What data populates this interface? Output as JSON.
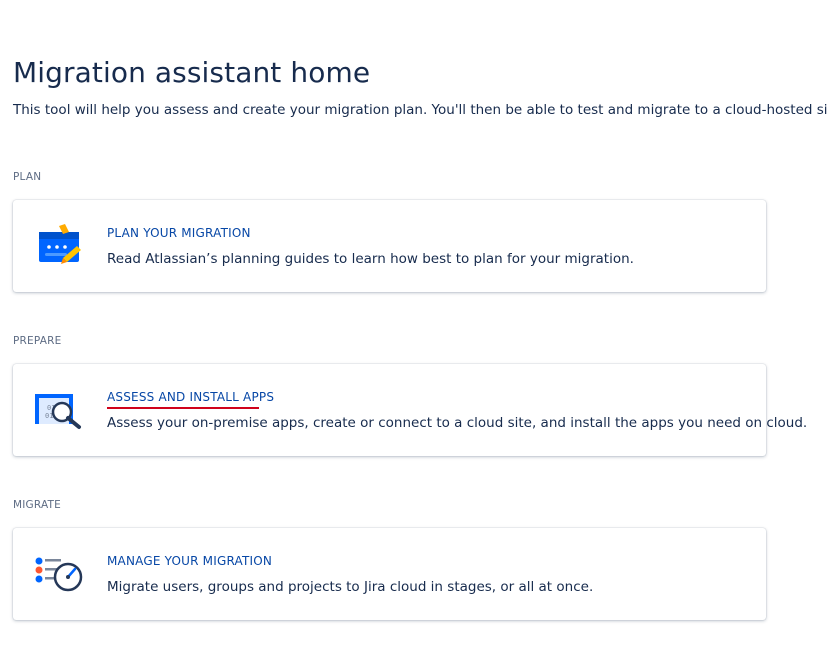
{
  "page": {
    "title": "Migration assistant home",
    "description": "This tool will help you assess and create your migration plan. You'll then be able to test and migrate to a cloud-hosted site."
  },
  "sections": [
    {
      "label": "PLAN",
      "card": {
        "icon": "plan-icon",
        "title": "PLAN YOUR MIGRATION",
        "text": "Read Atlassian’s planning guides to learn how best to plan for your migration."
      }
    },
    {
      "label": "PREPARE",
      "card": {
        "icon": "assess-apps-icon",
        "title": "ASSESS AND INSTALL APPS",
        "text": "Assess your on-premise apps, create or connect to a cloud site, and install the apps you need on cloud."
      }
    },
    {
      "label": "MIGRATE",
      "card": {
        "icon": "manage-migration-icon",
        "title": "MANAGE YOUR MIGRATION",
        "text": "Migrate users, groups and projects to Jira cloud in stages, or all at once."
      }
    }
  ],
  "colors": {
    "link": "#0747a6",
    "text": "#172b4d",
    "subtle": "#5e6c84",
    "accent_blue": "#0065ff",
    "accent_yellow": "#ffab00",
    "highlight_underline": "#d0021b"
  }
}
